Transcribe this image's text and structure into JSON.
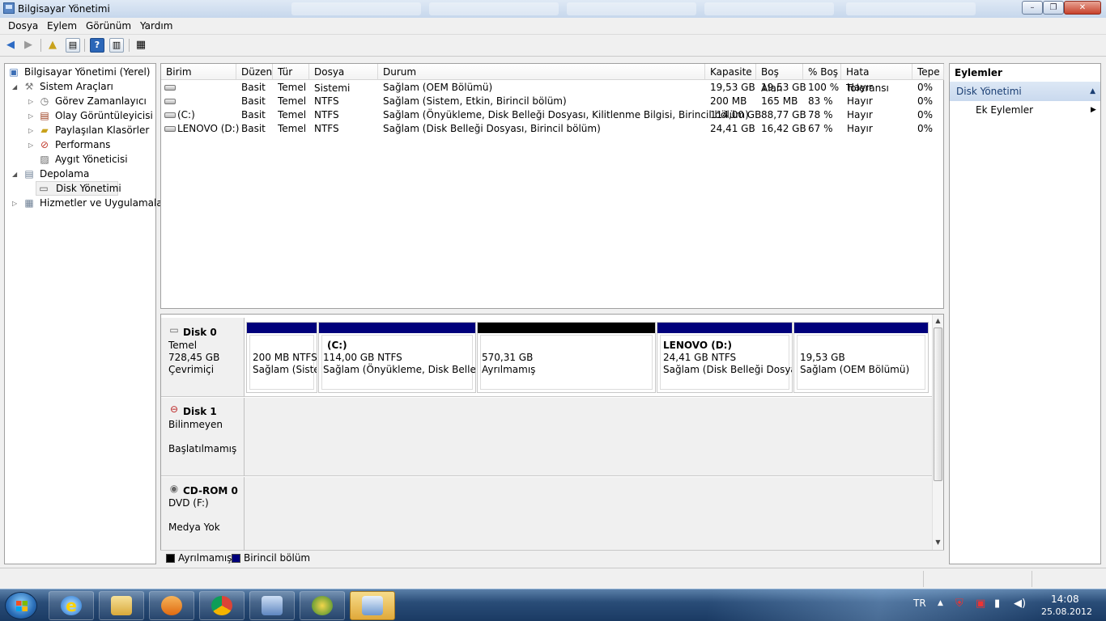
{
  "window": {
    "title": "Bilgisayar Yönetimi"
  },
  "menu": [
    "Dosya",
    "Eylem",
    "Görünüm",
    "Yardım"
  ],
  "tree": {
    "root": "Bilgisayar Yönetimi (Yerel)",
    "system_tools": "Sistem Araçları",
    "task_scheduler": "Görev Zamanlayıcı",
    "event_viewer": "Olay Görüntüleyicisi",
    "shared_folders": "Paylaşılan Klasörler",
    "performance": "Performans",
    "device_manager": "Aygıt Yöneticisi",
    "storage": "Depolama",
    "disk_management": "Disk Yönetimi",
    "services": "Hizmetler ve Uygulamalar"
  },
  "volumes": {
    "columns": [
      "Birim",
      "Düzen",
      "Tür",
      "Dosya Sistemi",
      "Durum",
      "Kapasite",
      "Boş Alan",
      "% Boş",
      "Hata Toleransı",
      "Tepe"
    ],
    "rows": [
      [
        "",
        "Basit",
        "Temel",
        "",
        "Sağlam (OEM Bölümü)",
        "19,53 GB",
        "19,53 GB",
        "100 %",
        "Hayır",
        "0%"
      ],
      [
        "",
        "Basit",
        "Temel",
        "NTFS",
        "Sağlam (Sistem, Etkin, Birincil bölüm)",
        "200 MB",
        "165 MB",
        "83 %",
        "Hayır",
        "0%"
      ],
      [
        "(C:)",
        "Basit",
        "Temel",
        "NTFS",
        "Sağlam (Önyükleme, Disk Belleği Dosyası, Kilitlenme Bilgisi, Birincil bölüm)",
        "114,00 GB",
        "88,77 GB",
        "78 %",
        "Hayır",
        "0%"
      ],
      [
        "LENOVO (D:)",
        "Basit",
        "Temel",
        "NTFS",
        "Sağlam (Disk Belleği Dosyası, Birincil bölüm)",
        "24,41 GB",
        "16,42 GB",
        "67 %",
        "Hayır",
        "0%"
      ]
    ]
  },
  "disks": {
    "disk0": {
      "name": "Disk 0",
      "type": "Temel",
      "size": "728,45 GB",
      "status": "Çevrimiçi"
    },
    "disk0_parts": [
      {
        "name": "",
        "size": "200 MB NTFS",
        "status": "Sağlam (Sistem, Etkin, Birincil bölüm)",
        "kind": "primary"
      },
      {
        "name": "(C:)",
        "size": "114,00 GB NTFS",
        "status": "Sağlam (Önyükleme, Disk Belleği Dosyası, Kilitlenme Bilgisi, Birincil bölüm)",
        "kind": "primary"
      },
      {
        "name": "",
        "size": "570,31 GB",
        "status": "Ayrılmamış",
        "kind": "unallocated"
      },
      {
        "name": "LENOVO  (D:)",
        "size": "24,41 GB NTFS",
        "status": "Sağlam (Disk Belleği Dosyası, Birincil bölüm)",
        "kind": "primary"
      },
      {
        "name": "",
        "size": "19,53 GB",
        "status": "Sağlam (OEM Bölümü)",
        "kind": "primary"
      }
    ],
    "disk1": {
      "name": "Disk 1",
      "type": "Bilinmeyen",
      "status": "Başlatılmamış"
    },
    "cdrom0": {
      "name": "CD-ROM 0",
      "type": "DVD (F:)",
      "status": "Medya Yok"
    }
  },
  "legend": {
    "unallocated": "Ayrılmamış",
    "primary": "Birincil bölüm"
  },
  "actions": {
    "header": "Eylemler",
    "section": "Disk Yönetimi",
    "more": "Ek Eylemler"
  },
  "tray": {
    "lang": "TR",
    "time": "14:08",
    "date": "25.08.2012"
  },
  "colors": {
    "primary_partition": "#00007b",
    "unallocated": "#000000",
    "action_section": "#c9d9ee"
  }
}
